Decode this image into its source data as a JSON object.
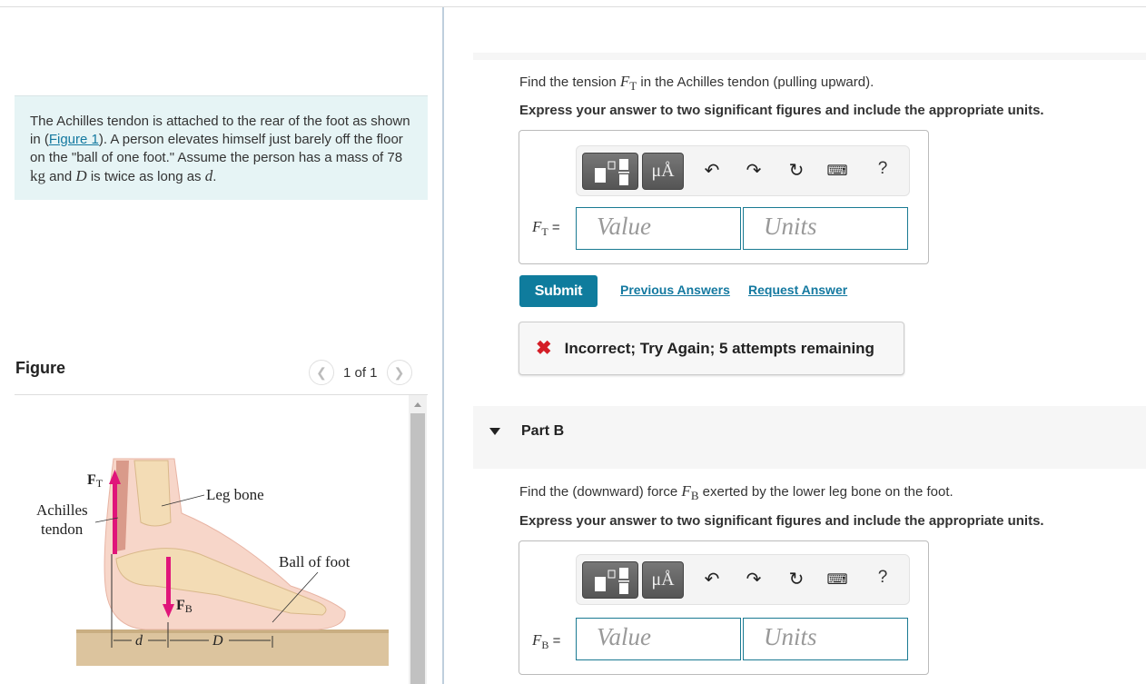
{
  "problem": {
    "text_1": "The Achilles tendon is attached to the rear of the foot as shown in (",
    "figure_link": "Figure 1",
    "text_2": "). A person elevates himself just barely off the floor on the \"ball of one foot.\" Assume the person has a mass of 78 ",
    "unit": "kg",
    "text_3": " and ",
    "var_D": "D",
    "text_4": " is twice as long as ",
    "var_d": "d",
    "text_5": "."
  },
  "figure": {
    "title": "Figure",
    "counter": "1 of 1",
    "prev_icon": "chevron-left-icon",
    "next_icon": "chevron-right-icon",
    "labels": {
      "ft": "F",
      "ft_sub": "T",
      "fb": "F",
      "fb_sub": "B",
      "achilles": "Achilles",
      "tendon": "tendon",
      "leg_bone": "Leg bone",
      "ball_of_foot": "Ball of foot",
      "d": "d",
      "D": "D"
    },
    "colors": {
      "arrow": "#e0157a",
      "skin": "#f6d2c4",
      "bone": "#f3dcb8",
      "floor": "#d9bf96"
    }
  },
  "partA": {
    "question_pre": "Find the tension ",
    "var": "F",
    "var_sub": "T",
    "question_post": " in the Achilles tendon (pulling upward).",
    "instruction": "Express your answer to two significant figures and include the appropriate units.",
    "label_eq": " =",
    "value_placeholder": "Value",
    "units_placeholder": "Units",
    "submit": "Submit",
    "previous_answers": "Previous Answers",
    "request_answer": "Request Answer",
    "feedback": "Incorrect; Try Again; 5 attempts remaining"
  },
  "toolbar": {
    "units_button": "μÅ",
    "help": "?",
    "icons": [
      "templates-icon",
      "units-icon",
      "undo-icon",
      "redo-icon",
      "reset-icon",
      "keyboard-icon",
      "help-icon"
    ]
  },
  "partB": {
    "title": "Part B",
    "question_pre": "Find the (downward) force ",
    "var": "F",
    "var_sub": "B",
    "question_post": " exerted by the lower leg bone on the foot.",
    "instruction": "Express your answer to two significant figures and include the appropriate units.",
    "label_eq": " =",
    "value_placeholder": "Value",
    "units_placeholder": "Units"
  }
}
